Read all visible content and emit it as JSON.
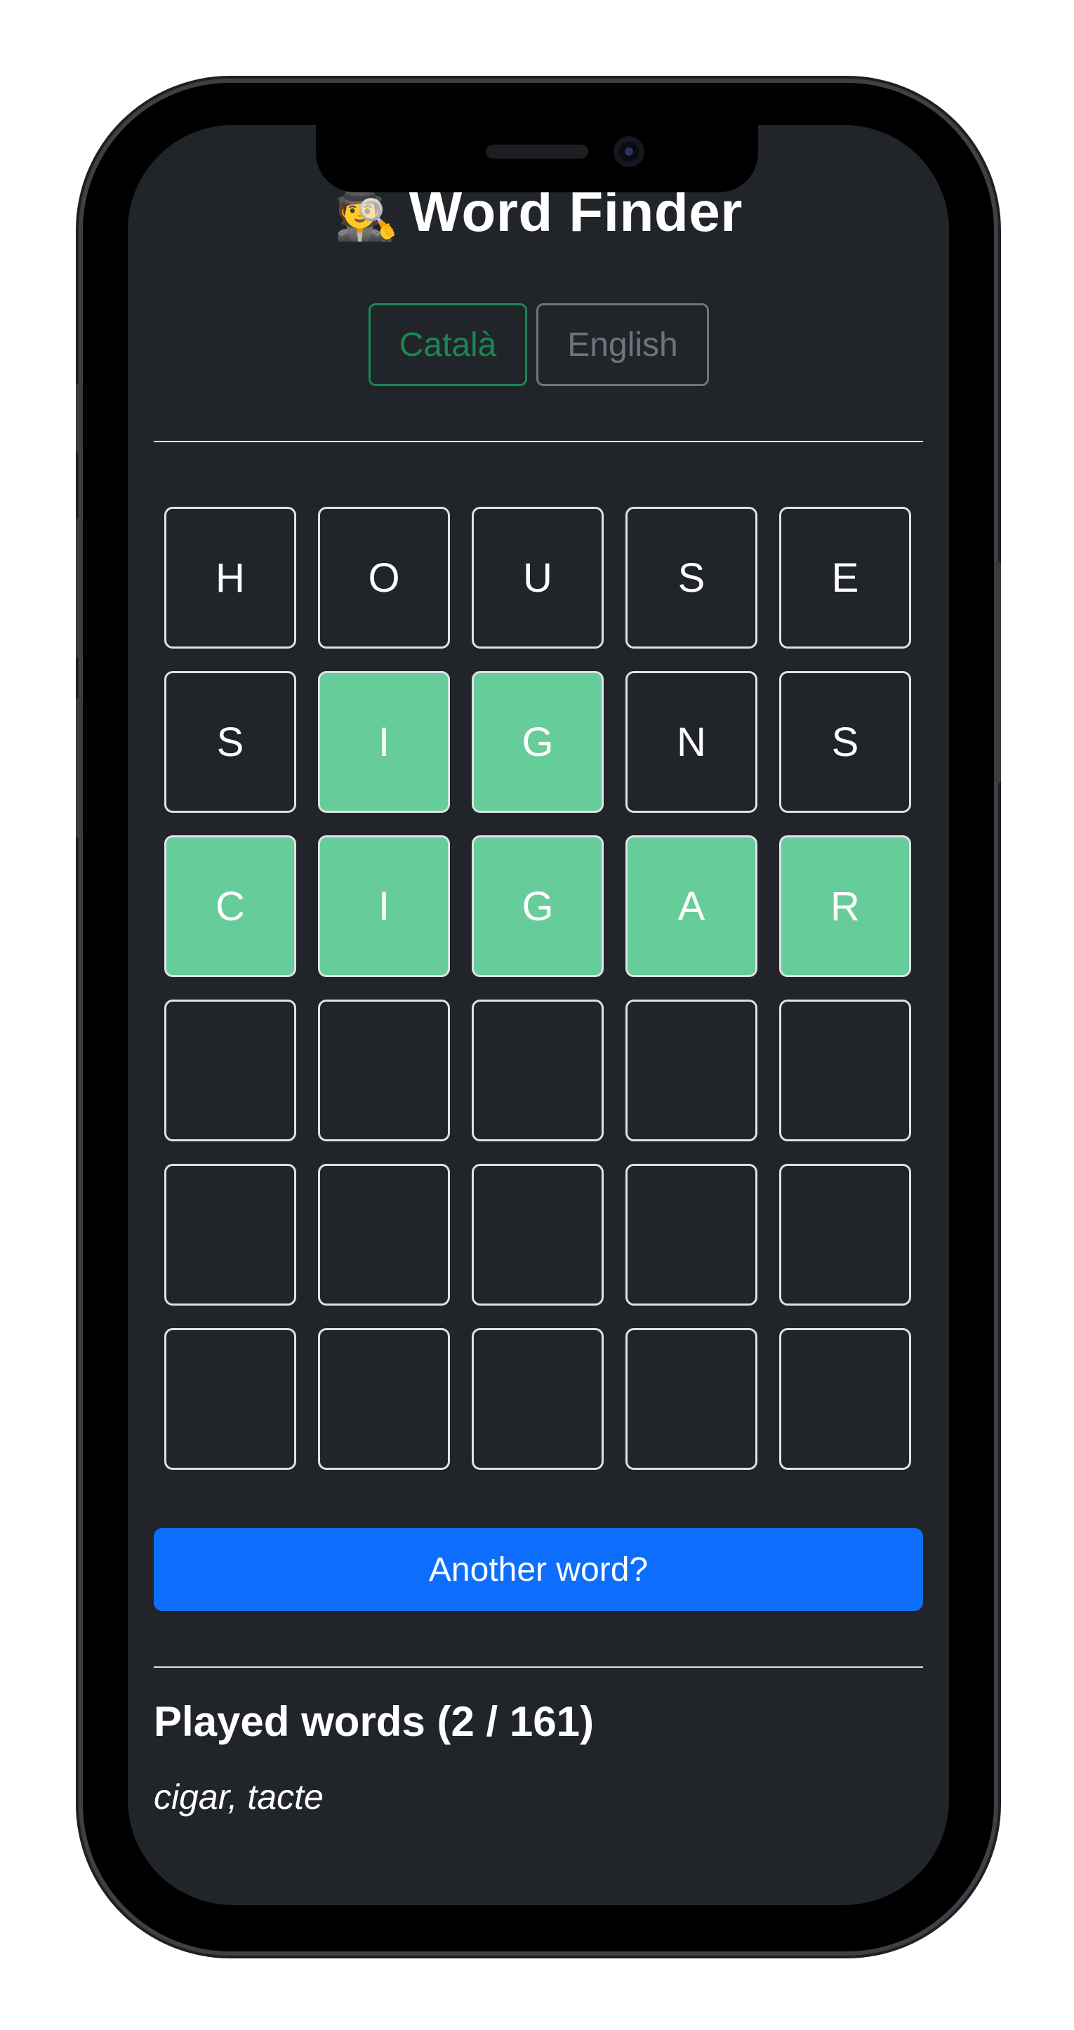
{
  "app": {
    "title_emoji": "🕵",
    "title": "Word Finder"
  },
  "languages": [
    {
      "label": "Català",
      "active": true
    },
    {
      "label": "English",
      "active": false
    }
  ],
  "board": [
    [
      {
        "letter": "H",
        "state": "absent"
      },
      {
        "letter": "O",
        "state": "absent"
      },
      {
        "letter": "U",
        "state": "absent"
      },
      {
        "letter": "S",
        "state": "absent"
      },
      {
        "letter": "E",
        "state": "absent"
      }
    ],
    [
      {
        "letter": "S",
        "state": "absent"
      },
      {
        "letter": "I",
        "state": "correct"
      },
      {
        "letter": "G",
        "state": "correct"
      },
      {
        "letter": "N",
        "state": "absent"
      },
      {
        "letter": "S",
        "state": "absent"
      }
    ],
    [
      {
        "letter": "C",
        "state": "correct"
      },
      {
        "letter": "I",
        "state": "correct"
      },
      {
        "letter": "G",
        "state": "correct"
      },
      {
        "letter": "A",
        "state": "correct"
      },
      {
        "letter": "R",
        "state": "correct"
      }
    ],
    [
      {
        "letter": "",
        "state": "empty"
      },
      {
        "letter": "",
        "state": "empty"
      },
      {
        "letter": "",
        "state": "empty"
      },
      {
        "letter": "",
        "state": "empty"
      },
      {
        "letter": "",
        "state": "empty"
      }
    ],
    [
      {
        "letter": "",
        "state": "empty"
      },
      {
        "letter": "",
        "state": "empty"
      },
      {
        "letter": "",
        "state": "empty"
      },
      {
        "letter": "",
        "state": "empty"
      },
      {
        "letter": "",
        "state": "empty"
      }
    ],
    [
      {
        "letter": "",
        "state": "empty"
      },
      {
        "letter": "",
        "state": "empty"
      },
      {
        "letter": "",
        "state": "empty"
      },
      {
        "letter": "",
        "state": "empty"
      },
      {
        "letter": "",
        "state": "empty"
      }
    ]
  ],
  "actions": {
    "another_word_label": "Another word?"
  },
  "played": {
    "heading": "Played words (2 / 161)",
    "words": "cigar, tacte"
  },
  "colors": {
    "background": "#212529",
    "correct_tile": "#66cc99",
    "primary_button": "#0d6efd",
    "active_language": "#198754",
    "inactive_language": "#6c757d"
  }
}
